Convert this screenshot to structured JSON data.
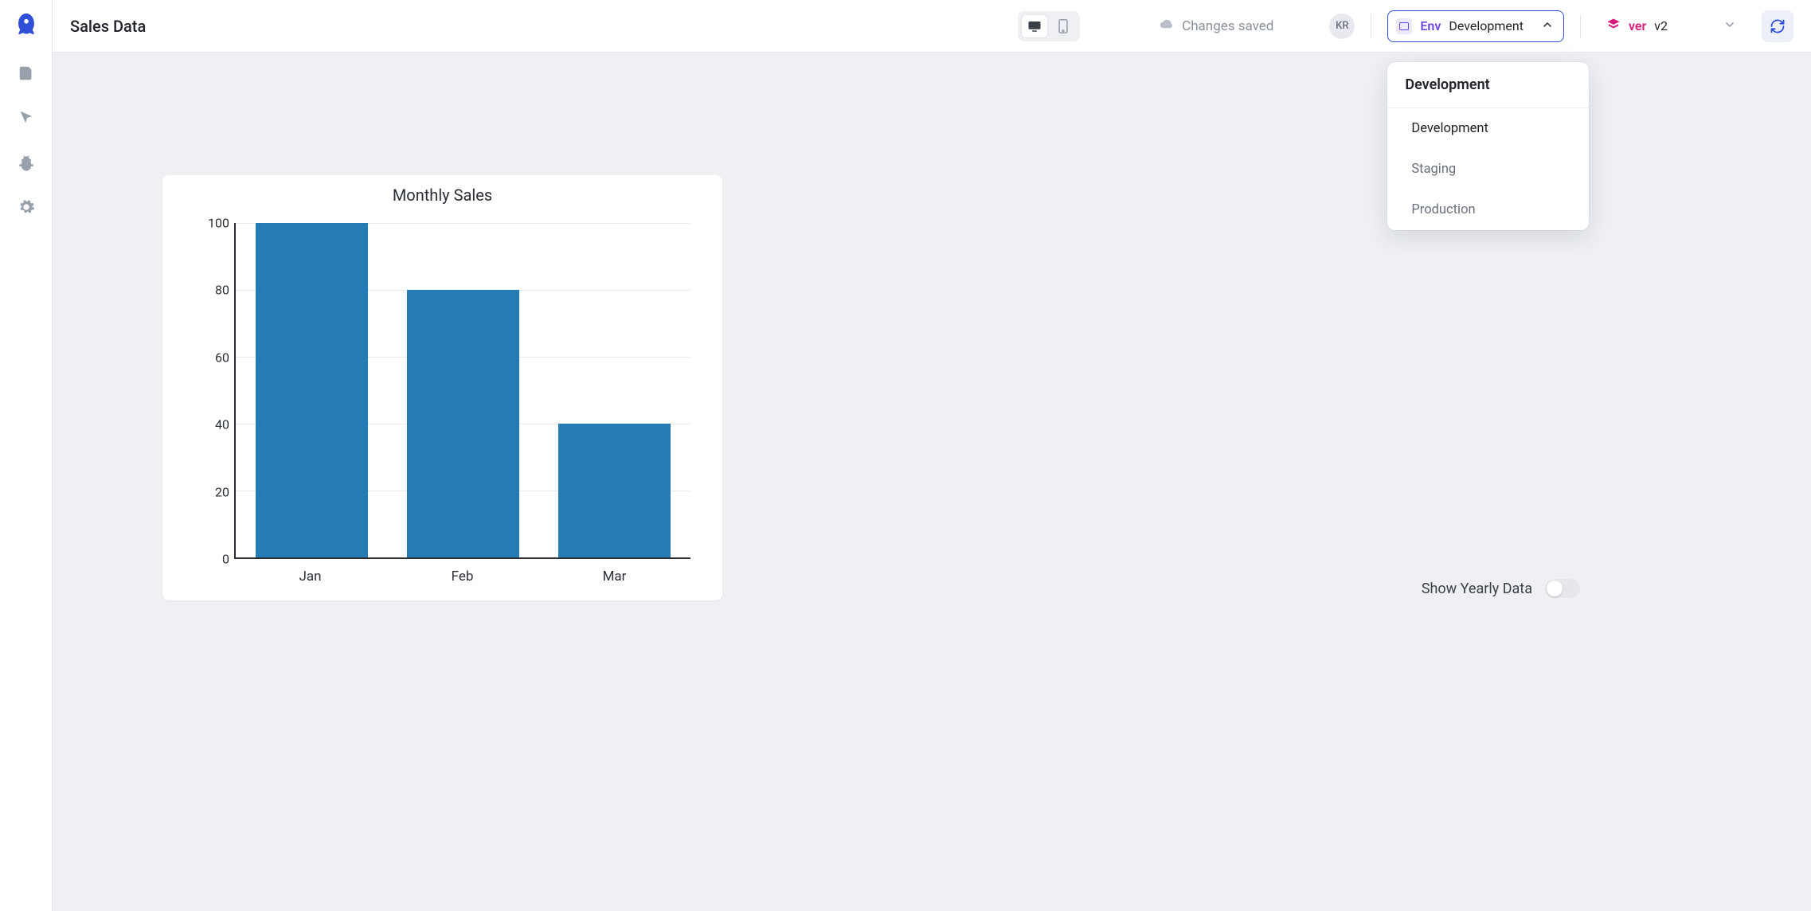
{
  "header": {
    "title": "Sales Data",
    "save_status": "Changes saved",
    "avatar_initials": "KR",
    "env": {
      "label": "Env",
      "value": "Development",
      "dropdown_head": "Development",
      "options": [
        "Development",
        "Staging",
        "Production"
      ]
    },
    "version": {
      "label": "ver",
      "value": "v2"
    }
  },
  "canvas": {
    "yearly_toggle_label": "Show Yearly Data",
    "yearly_toggle_on": false
  },
  "chart_data": {
    "type": "bar",
    "title": "Monthly Sales",
    "categories": [
      "Jan",
      "Feb",
      "Mar"
    ],
    "values": [
      100,
      80,
      40
    ],
    "xlabel": "",
    "ylabel": "",
    "ylim": [
      0,
      100
    ],
    "yticks": [
      0,
      20,
      40,
      60,
      80,
      100
    ],
    "bar_color": "#257bb4"
  }
}
